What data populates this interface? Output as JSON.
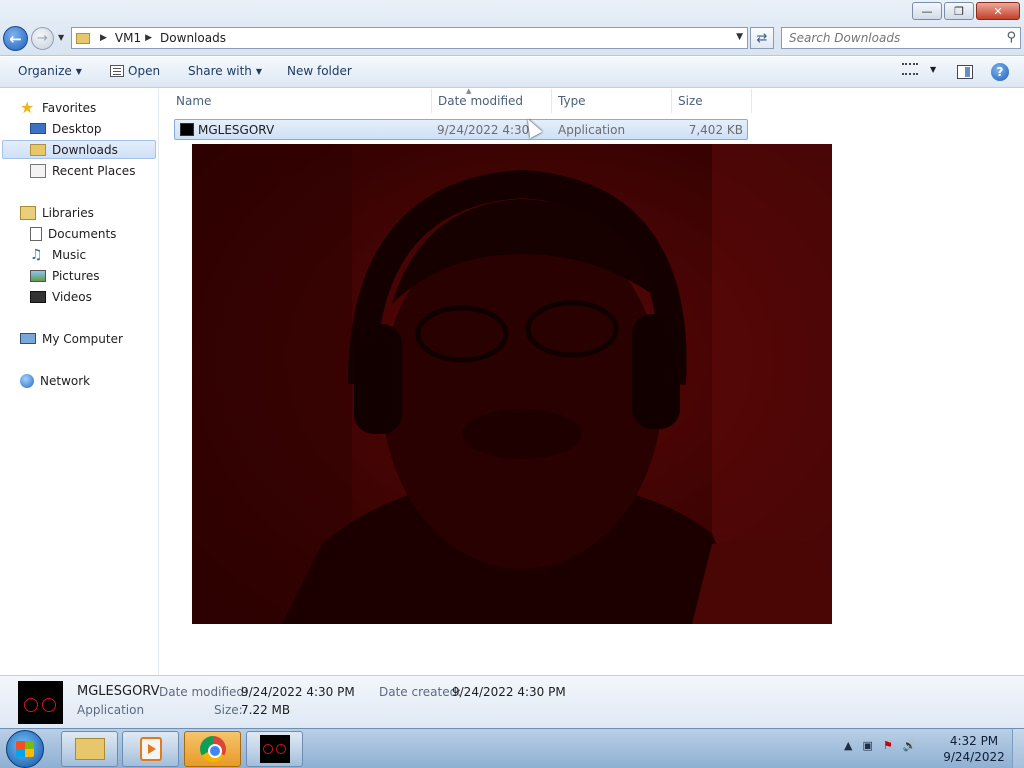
{
  "window": {
    "minimize_icon": "minimize-icon",
    "maximize_icon": "restore-icon",
    "close_icon": "close-icon"
  },
  "address_bar": {
    "crumbs": [
      "VM1",
      "Downloads"
    ],
    "search_placeholder": "Search Downloads"
  },
  "toolbar": {
    "organize": "Organize",
    "open": "Open",
    "share_with": "Share with",
    "new_folder": "New folder"
  },
  "nav": {
    "favorites": "Favorites",
    "desktop": "Desktop",
    "downloads": "Downloads",
    "recent_places": "Recent Places",
    "libraries": "Libraries",
    "documents": "Documents",
    "music": "Music",
    "pictures": "Pictures",
    "videos": "Videos",
    "my_computer": "My Computer",
    "network": "Network",
    "selected": "Downloads"
  },
  "file_list": {
    "columns": [
      "Name",
      "Date modified",
      "Type",
      "Size"
    ],
    "rows": [
      {
        "name": "MGLESGORV",
        "date_modified": "9/24/2022 4:30 PM",
        "type": "Application",
        "size": "7,402 KB"
      }
    ]
  },
  "details": {
    "name": "MGLESGORV",
    "type": "Application",
    "date_modified_label": "Date modified:",
    "date_modified": "9/24/2022 4:30 PM",
    "date_created_label": "Date created:",
    "date_created": "9/24/2022 4:30 PM",
    "size_label": "Size:",
    "size": "7.22 MB"
  },
  "taskbar": {
    "time": "4:32 PM",
    "date": "9/24/2022"
  },
  "colors": {
    "selection": "#cde0f7",
    "webcam_tint": "#4a0303",
    "taskbar_active": "#e79a28"
  }
}
